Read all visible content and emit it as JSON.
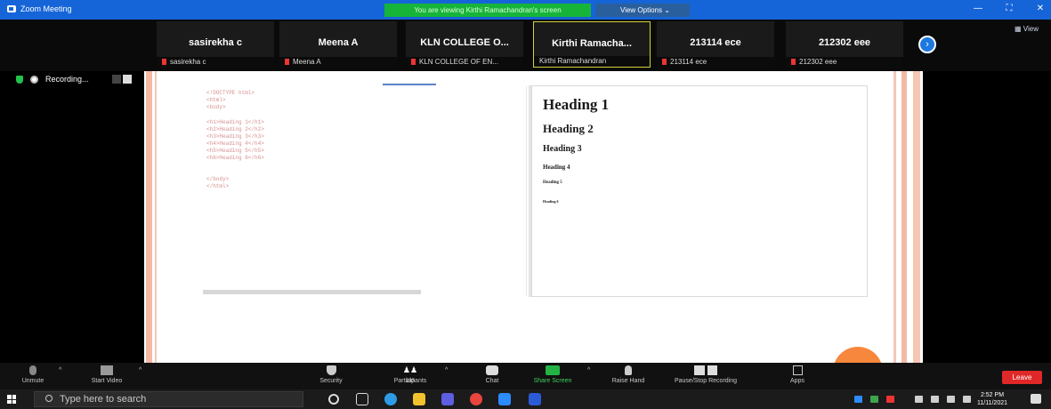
{
  "window": {
    "app_title": "Zoom Meeting",
    "share_banner": "You are viewing Kirthi Ramachandran's screen",
    "view_options": "View Options ⌄",
    "minimize": "—",
    "fullscreen": "⛶",
    "close": "✕"
  },
  "participants": [
    {
      "name": "sasirekha c",
      "label": "sasirekha c"
    },
    {
      "name": "Meena A",
      "label": "Meena A"
    },
    {
      "name": "KLN COLLEGE O...",
      "label": "KLN COLLEGE OF EN..."
    },
    {
      "name": "Kirthi Ramacha...",
      "label": "Kirthi Ramachandran",
      "active": true
    },
    {
      "name": "213114 ece",
      "label": "213114 ece"
    },
    {
      "name": "212302 eee",
      "label": "212302 eee"
    }
  ],
  "strip": {
    "next": "›",
    "view": "▦ View"
  },
  "recording": {
    "label": "Recording..."
  },
  "code": {
    "lines": [
      "<!DOCTYPE html>",
      "<html>",
      "<body>",
      "",
      "<h1>Heading 1</h1>",
      "<h2>Heading 2</h2>",
      "<h3>Heading 3</h3>",
      "<h4>Heading 4</h4>",
      "<h5>Heading 5</h5>",
      "<h6>Heading 6</h6>",
      "",
      "</body>",
      "</html>"
    ]
  },
  "preview": {
    "h1": "Heading 1",
    "h2": "Heading 2",
    "h3": "Heading 3",
    "h4": "Heading 4",
    "h5": "Heading 5",
    "h6": "Heading 6"
  },
  "controls": {
    "unmute": "Unmute",
    "start_video": "Start Video",
    "security": "Security",
    "participants": "Participants",
    "participant_count": "383",
    "chat": "Chat",
    "share_screen": "Share Screen",
    "raise_hand": "Raise Hand",
    "pause_recording": "Pause/Stop Recording",
    "apps": "Apps",
    "leave": "Leave",
    "caret": "^"
  },
  "taskbar": {
    "search_placeholder": "Type here to search",
    "time": "2:52 PM",
    "date": "11/11/2021"
  }
}
